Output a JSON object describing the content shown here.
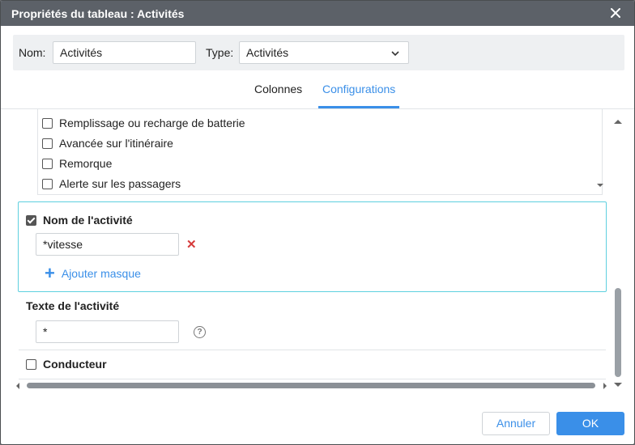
{
  "dialog": {
    "title": "Propriétés du tableau : Activités"
  },
  "namebar": {
    "name_label": "Nom:",
    "name_value": "Activités",
    "type_label": "Type:",
    "type_value": "Activités"
  },
  "tabs": [
    {
      "label": "Colonnes",
      "active": false
    },
    {
      "label": "Configurations",
      "active": true
    }
  ],
  "event_list": {
    "items": [
      {
        "label": "Remplissage ou recharge de batterie",
        "checked": false
      },
      {
        "label": "Avancée sur l'itinéraire",
        "checked": false
      },
      {
        "label": "Remorque",
        "checked": false
      },
      {
        "label": "Alerte sur les passagers",
        "checked": false
      }
    ]
  },
  "activity_name": {
    "title": "Nom de l'activité",
    "checked": true,
    "mask_value": "*vitesse",
    "add_mask_label": "Ajouter masque"
  },
  "activity_text": {
    "title": "Texte de l'activité",
    "value": "*"
  },
  "driver": {
    "title": "Conducteur",
    "checked": false
  },
  "footer": {
    "cancel_label": "Annuler",
    "ok_label": "OK"
  },
  "colors": {
    "accent": "#3a8fe8",
    "titlebar": "#5c6168",
    "highlight_border": "#5ed0df",
    "delete": "#d63b3b"
  }
}
